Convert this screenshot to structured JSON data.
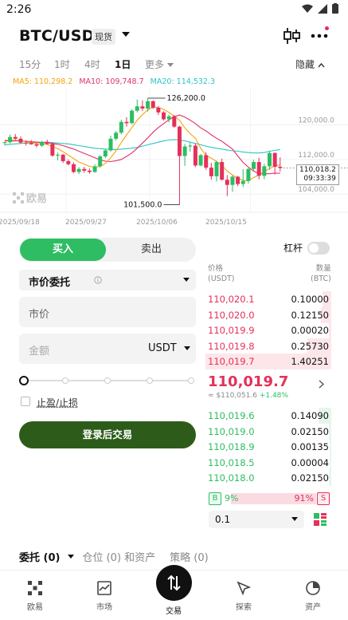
{
  "status_bar": {
    "time": "2:26"
  },
  "header": {
    "pair": "BTC/USDT",
    "market_badge": "现货"
  },
  "timeframes": {
    "tabs": [
      "15分",
      "1时",
      "4时",
      "1日"
    ],
    "active": "1日",
    "more": "更多",
    "hide": "隐藏"
  },
  "ma": {
    "ma5": "MA5: 110,298.2",
    "ma10": "MA10: 109,748.7",
    "ma20": "MA20: 114,532.3"
  },
  "chart_data": {
    "type": "candlestick",
    "x_ticks": [
      "2025/09/18",
      "2025/09/27",
      "2025/10/06",
      "2025/10/15"
    ],
    "y_ticks": [
      "120,000.0",
      "112,000.0",
      "104,000.0"
    ],
    "ylim": [
      100500,
      127500
    ],
    "high_label": "126,200.0",
    "low_label": "101,500.0",
    "last_price": "110,018.2",
    "countdown": "09:33:39",
    "candles": [
      [
        115800,
        116200,
        115200,
        116000
      ],
      [
        116000,
        117800,
        115700,
        117200
      ],
      [
        117200,
        117900,
        116600,
        116800
      ],
      [
        116800,
        117300,
        115600,
        115900
      ],
      [
        115900,
        116400,
        115200,
        115800
      ],
      [
        115800,
        116500,
        115400,
        115500
      ],
      [
        115500,
        115900,
        114800,
        115200
      ],
      [
        115200,
        116300,
        114900,
        116000
      ],
      [
        116000,
        116600,
        115400,
        115600
      ],
      [
        115600,
        115900,
        112600,
        112900
      ],
      [
        112900,
        113600,
        111800,
        113100
      ],
      [
        113100,
        113300,
        111200,
        111600
      ],
      [
        111600,
        112000,
        110600,
        110900
      ],
      [
        110900,
        111300,
        108800,
        109100
      ],
      [
        109100,
        110200,
        108600,
        109800
      ],
      [
        109800,
        110300,
        108900,
        109400
      ],
      [
        109400,
        109900,
        108700,
        109100
      ],
      [
        109100,
        110900,
        108900,
        110400
      ],
      [
        110400,
        113000,
        110100,
        112700
      ],
      [
        112700,
        114400,
        112300,
        114100
      ],
      [
        114100,
        117500,
        113800,
        116800
      ],
      [
        116800,
        118600,
        116400,
        118200
      ],
      [
        118200,
        121200,
        117800,
        120700
      ],
      [
        120700,
        121800,
        119600,
        120400
      ],
      [
        120400,
        123600,
        120200,
        123300
      ],
      [
        123300,
        125900,
        122900,
        124300
      ],
      [
        124300,
        125700,
        123200,
        123800
      ],
      [
        123800,
        126200,
        123100,
        125500
      ],
      [
        125500,
        125700,
        123700,
        124000
      ],
      [
        124000,
        124400,
        122300,
        122900
      ],
      [
        122900,
        123200,
        121000,
        121300
      ],
      [
        121300,
        122400,
        120600,
        122000
      ],
      [
        122000,
        122300,
        119300,
        119600
      ],
      [
        119600,
        119800,
        101500,
        112800
      ],
      [
        112800,
        115600,
        110500,
        115000
      ],
      [
        115000,
        115900,
        113800,
        115200
      ],
      [
        115200,
        115700,
        110200,
        110600
      ],
      [
        110600,
        113300,
        110400,
        113000
      ],
      [
        113000,
        113700,
        109600,
        110100
      ],
      [
        110100,
        111200,
        107300,
        108100
      ],
      [
        108100,
        111700,
        106900,
        111400
      ],
      [
        111400,
        112200,
        107100,
        107300
      ],
      [
        107300,
        108400,
        103500,
        106100
      ],
      [
        106100,
        108300,
        104500,
        108000
      ],
      [
        108000,
        108200,
        105800,
        106300
      ],
      [
        106300,
        109800,
        105600,
        107000
      ],
      [
        107000,
        110000,
        106400,
        109800
      ],
      [
        109800,
        111900,
        109400,
        111400
      ],
      [
        111400,
        112400,
        107400,
        108200
      ],
      [
        108200,
        111000,
        107400,
        110400
      ],
      [
        110400,
        114000,
        109600,
        113500
      ],
      [
        113500,
        113600,
        108500,
        110300
      ],
      [
        110300,
        112500,
        109200,
        110018
      ]
    ],
    "ma5": [
      116500,
      116400,
      116500,
      116300,
      116100,
      115900,
      115700,
      115600,
      115500,
      115000,
      114500,
      113800,
      113000,
      112200,
      111400,
      110900,
      110400,
      110200,
      110400,
      111100,
      112400,
      114000,
      115900,
      117700,
      119400,
      121100,
      122400,
      123500,
      124100,
      124000,
      123600,
      122900,
      122000,
      121100,
      119300,
      118000,
      116900,
      114600,
      112900,
      112300,
      111500,
      110600,
      109300,
      108400,
      107700,
      107100,
      107100,
      107800,
      108400,
      109200,
      109900,
      110500,
      110700
    ],
    "ma10": [
      116300,
      116300,
      116300,
      116300,
      116200,
      116100,
      116000,
      115900,
      115900,
      115700,
      115500,
      115200,
      114800,
      114400,
      113900,
      113400,
      112900,
      112400,
      111900,
      111600,
      111500,
      111700,
      112000,
      112700,
      113500,
      114600,
      115800,
      117000,
      118300,
      119400,
      120300,
      121200,
      121900,
      122300,
      121800,
      121100,
      120300,
      119300,
      118600,
      117700,
      116900,
      116200,
      115300,
      114400,
      112800,
      111300,
      110200,
      109300,
      108700,
      108700,
      108700,
      108800,
      108800
    ],
    "ma20": [
      115400,
      115500,
      115600,
      115700,
      115800,
      115900,
      116000,
      116000,
      116000,
      115900,
      115800,
      115700,
      115600,
      115400,
      115200,
      115000,
      114800,
      114600,
      114500,
      114400,
      114300,
      114300,
      114400,
      114500,
      114600,
      114800,
      115100,
      115400,
      115700,
      116000,
      116300,
      116500,
      116600,
      116500,
      116300,
      116000,
      115700,
      115400,
      115100,
      114800,
      114600,
      114400,
      114200,
      114000,
      113900,
      113700,
      113600,
      113500,
      113500,
      113600,
      113900,
      114100,
      114300
    ]
  },
  "watermark": "欧易",
  "form": {
    "buy_label": "买入",
    "sell_label": "卖出",
    "order_type": "市价委托",
    "market_price": "市价",
    "amount_placeholder": "金额",
    "currency": "USDT",
    "tpsl_label": "止盈/止损",
    "login_button": "登录后交易",
    "slider_percent": 0
  },
  "leverage": {
    "label": "杠杆",
    "enabled": false
  },
  "orderbook": {
    "price_header": "价格",
    "price_unit": "(USDT)",
    "qty_header": "数量",
    "qty_unit": "(BTC)",
    "asks": [
      {
        "price": "110,020.1",
        "qty": "0.10000",
        "depth": 0.07
      },
      {
        "price": "110,020.0",
        "qty": "0.12150",
        "depth": 0.08
      },
      {
        "price": "110,019.9",
        "qty": "0.00020",
        "depth": 0.02
      },
      {
        "price": "110,019.8",
        "qty": "0.25730",
        "depth": 0.19
      },
      {
        "price": "110,019.7",
        "qty": "1.40251",
        "depth": 1.0
      }
    ],
    "bids": [
      {
        "price": "110,019.6",
        "qty": "0.14090",
        "depth": 0.1
      },
      {
        "price": "110,019.0",
        "qty": "0.02150",
        "depth": 0.02
      },
      {
        "price": "110,018.9",
        "qty": "0.00135",
        "depth": 0.01
      },
      {
        "price": "110,018.5",
        "qty": "0.00004",
        "depth": 0.01
      },
      {
        "price": "110,018.0",
        "qty": "0.02150",
        "depth": 0.02
      }
    ],
    "mid_price": "110,019.7",
    "mid_usd": "≈ $110,051.6",
    "mid_change": "+1.48%",
    "buy_ratio_label": "9%",
    "sell_ratio_label": "91%",
    "buy_ratio": 0.09,
    "b_badge": "B",
    "s_badge": "S",
    "precision": "0.1"
  },
  "bottom_tabs": {
    "orders": "委托 (0)",
    "positions": "仓位 (0) 和资产",
    "strategy": "策略 (0)"
  },
  "nav": {
    "home": "欧易",
    "market": "市场",
    "trade": "交易",
    "explore": "探索",
    "assets": "资产"
  },
  "colors": {
    "up": "#2ebd62",
    "down": "#e5305a",
    "login": "#2d5c1a"
  }
}
